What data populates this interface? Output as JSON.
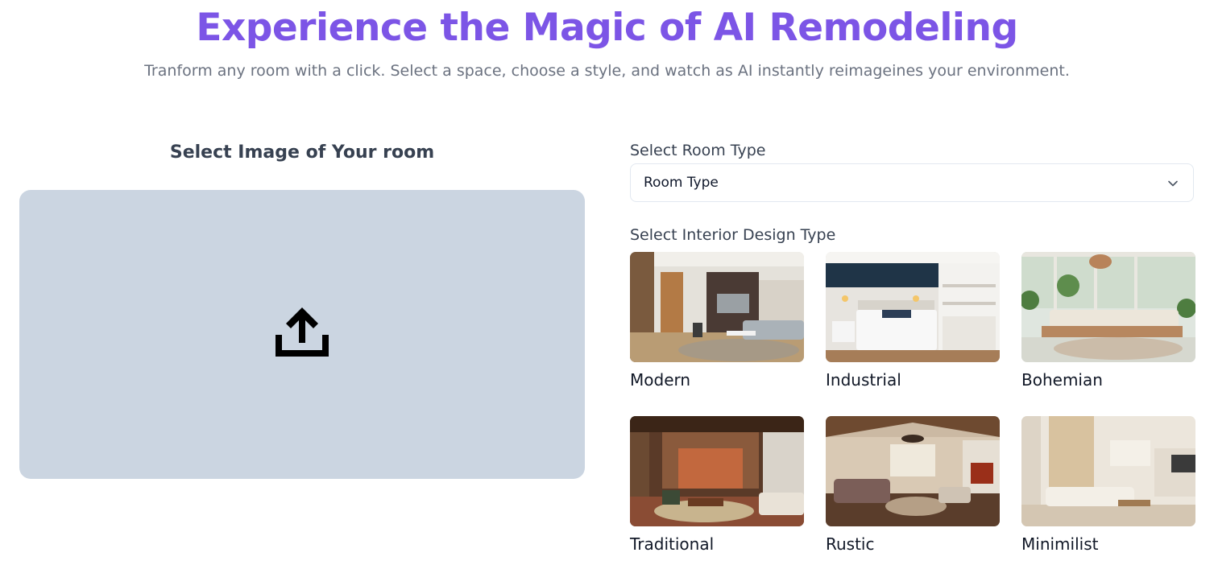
{
  "hero": {
    "title": "Experience the Magic of AI Remodeling",
    "subtitle": "Tranform any room with a click. Select a space, choose a style, and watch as AI instantly reimageines your environment."
  },
  "upload": {
    "heading": "Select Image of Your room",
    "icon": "upload-icon"
  },
  "room_type": {
    "label": "Select Room Type",
    "selected": "Room Type",
    "icon": "chevron-down-icon"
  },
  "design_type": {
    "label": "Select Interior Design Type",
    "options": [
      {
        "label": "Modern"
      },
      {
        "label": "Industrial"
      },
      {
        "label": "Bohemian"
      },
      {
        "label": "Traditional"
      },
      {
        "label": "Rustic"
      },
      {
        "label": "Minimilist"
      }
    ]
  },
  "colors": {
    "title": "#7c55e6",
    "subtitle": "#6b7280",
    "heading": "#374151",
    "upload_bg": "#cbd5e1",
    "icon": "#000000"
  }
}
